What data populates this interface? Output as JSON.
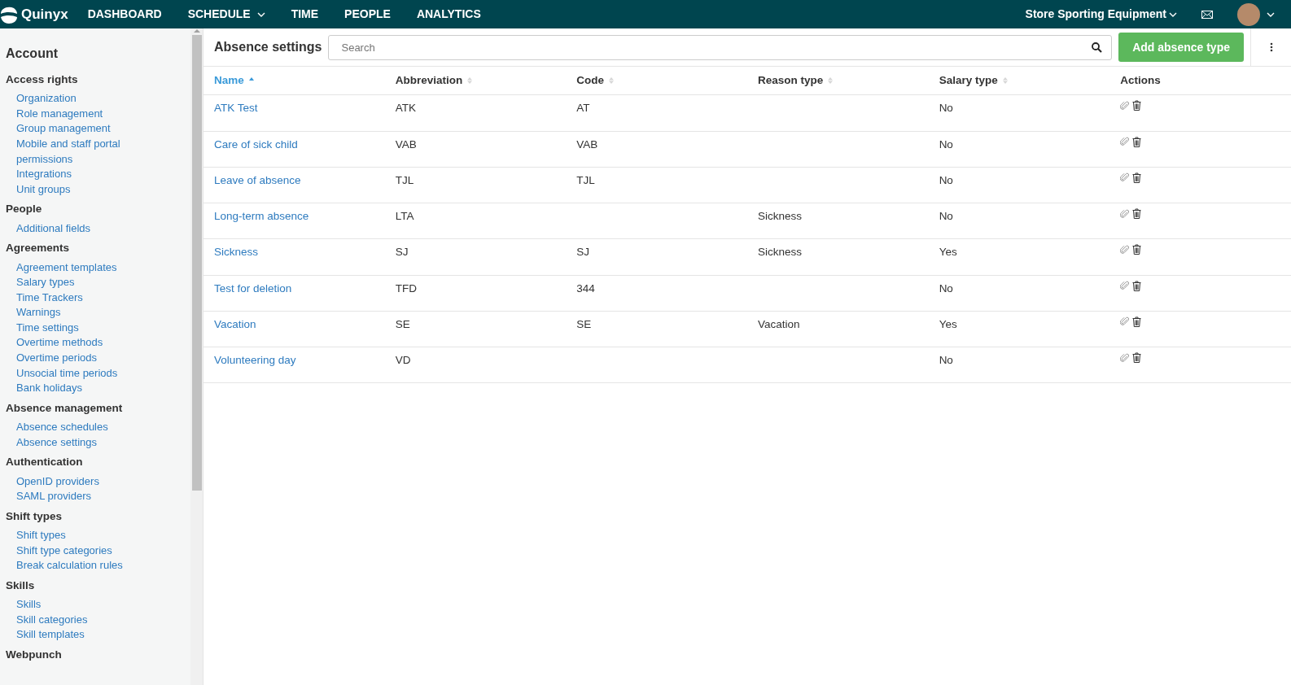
{
  "top_bar": {
    "logo_text": "Quinyx",
    "nav": [
      {
        "label": "DASHBOARD",
        "has_menu": false
      },
      {
        "label": "SCHEDULE",
        "has_menu": true
      },
      {
        "label": "TIME",
        "has_menu": false
      },
      {
        "label": "PEOPLE",
        "has_menu": false
      },
      {
        "label": "ANALYTICS",
        "has_menu": false
      }
    ],
    "unit": "Store Sporting Equipment"
  },
  "sidebar": {
    "title": "Account",
    "groups": [
      {
        "heading": "Access rights",
        "items": [
          "Organization",
          "Role management",
          "Group management",
          "Mobile and staff portal permissions",
          "Integrations",
          "Unit groups"
        ]
      },
      {
        "heading": "People",
        "items": [
          "Additional fields"
        ]
      },
      {
        "heading": "Agreements",
        "items": [
          "Agreement templates",
          "Salary types",
          "Time Trackers",
          "Warnings",
          "Time settings",
          "Overtime methods",
          "Overtime periods",
          "Unsocial time periods",
          "Bank holidays"
        ]
      },
      {
        "heading": "Absence management",
        "items": [
          "Absence schedules",
          "Absence settings"
        ]
      },
      {
        "heading": "Authentication",
        "items": [
          "OpenID providers",
          "SAML providers"
        ]
      },
      {
        "heading": "Shift types",
        "items": [
          "Shift types",
          "Shift type categories",
          "Break calculation rules"
        ]
      },
      {
        "heading": "Skills",
        "items": [
          "Skills",
          "Skill categories",
          "Skill templates"
        ]
      },
      {
        "heading": "Webpunch"
      }
    ]
  },
  "page": {
    "title": "Absence settings",
    "search": {
      "placeholder": "Search"
    },
    "add_button": "Add absence type"
  },
  "table": {
    "columns": [
      {
        "label": "Name",
        "sortable": true,
        "sorted": true
      },
      {
        "label": "Abbreviation",
        "sortable": true,
        "sorted": false
      },
      {
        "label": "Code",
        "sortable": true,
        "sorted": false
      },
      {
        "label": "Reason type",
        "sortable": true,
        "sorted": false
      },
      {
        "label": "Salary type",
        "sortable": true,
        "sorted": false
      },
      {
        "label": "Actions",
        "sortable": false,
        "sorted": false
      }
    ],
    "rows": [
      {
        "name": "ATK Test",
        "abbreviation": "ATK",
        "code": "AT",
        "salary_type": "No"
      },
      {
        "name": "Care of sick child",
        "abbreviation": "VAB",
        "code": "VAB",
        "salary_type": "No"
      },
      {
        "name": "Leave of absence",
        "abbreviation": "TJL",
        "code": "TJL",
        "salary_type": "No"
      },
      {
        "name": "Long-term absence",
        "abbreviation": "LTA",
        "reason_type": "Sickness",
        "salary_type": "No"
      },
      {
        "name": "Sickness",
        "abbreviation": "SJ",
        "code": "SJ",
        "reason_type": "Sickness",
        "salary_type": "Yes"
      },
      {
        "name": "Test for deletion",
        "abbreviation": "TFD",
        "code": "344",
        "salary_type": "No"
      },
      {
        "name": "Vacation",
        "abbreviation": "SE",
        "code": "SE",
        "reason_type": "Vacation",
        "salary_type": "Yes"
      },
      {
        "name": "Volunteering day",
        "abbreviation": "VD",
        "salary_type": "No"
      }
    ]
  }
}
